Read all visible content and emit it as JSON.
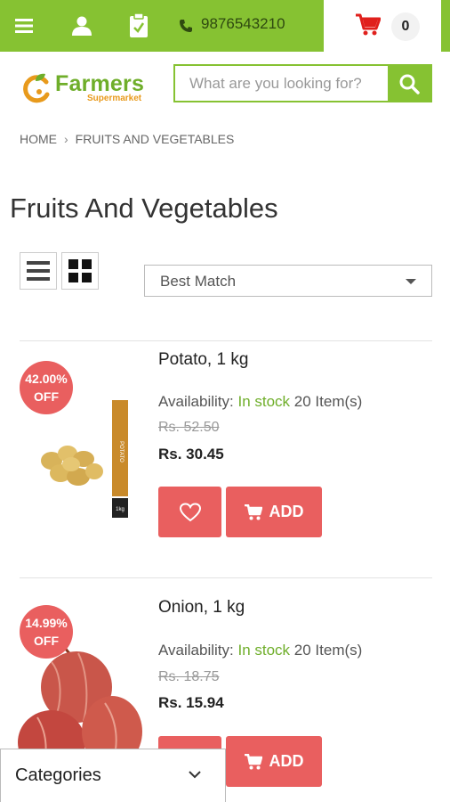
{
  "header": {
    "phone": "9876543210",
    "cart_count": "0",
    "logo_word": "Farmers",
    "logo_sub": "Supermarket",
    "search_placeholder": "What are you looking for?"
  },
  "breadcrumb": {
    "home": "HOME",
    "current": "FRUITS AND VEGETABLES"
  },
  "page_title": "Fruits And Vegetables",
  "sort": {
    "selected": "Best Match"
  },
  "products": [
    {
      "name": "Potato, 1 kg",
      "discount_line1": "42.00%",
      "discount_line2": "OFF",
      "availability_label": "Availability:",
      "stock": "In stock",
      "qty": "20 Item(s)",
      "old_price": "Rs. 52.50",
      "price": "Rs. 30.45",
      "add_label": "ADD",
      "pack_text": "POTATO",
      "pack_weight": "1kg"
    },
    {
      "name": "Onion, 1 kg",
      "discount_line1": "14.99%",
      "discount_line2": "OFF",
      "availability_label": "Availability:",
      "stock": "In stock",
      "qty": "20 Item(s)",
      "old_price": "Rs. 18.75",
      "price": "Rs. 15.94",
      "add_label": "ADD"
    }
  ],
  "categories_label": "Categories",
  "colors": {
    "brand_green": "#86c232",
    "accent_red": "#e95f5f",
    "stock_green": "#6fae2a"
  }
}
